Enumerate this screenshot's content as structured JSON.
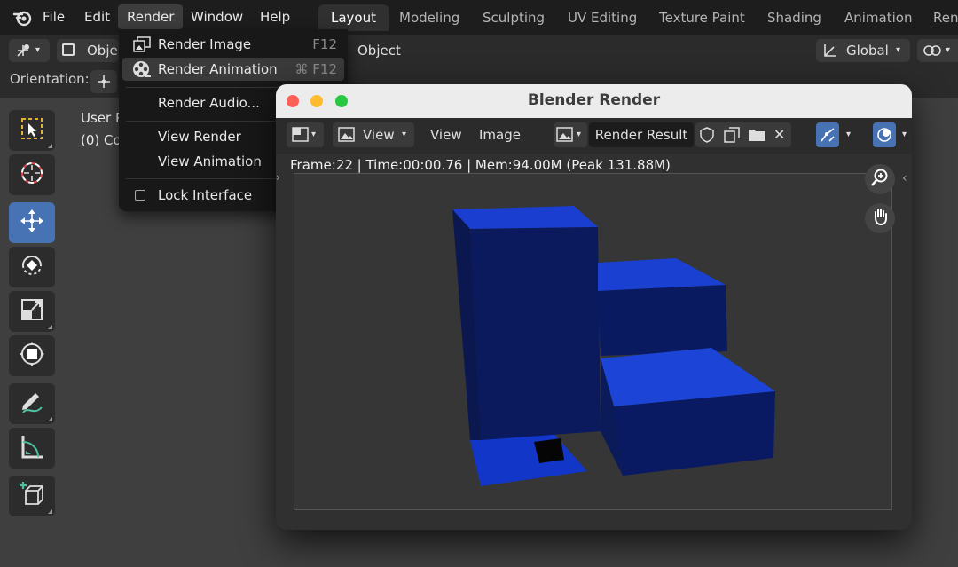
{
  "topbar": {
    "menus": [
      "File",
      "Edit",
      "Render",
      "Window",
      "Help"
    ],
    "workspaces": [
      "Layout",
      "Modeling",
      "Sculpting",
      "UV Editing",
      "Texture Paint",
      "Shading",
      "Animation",
      "Ren"
    ]
  },
  "header": {
    "object_mode": "Obje",
    "object_menu": "Object",
    "transform_orientation": "Global"
  },
  "orientation_label": "Orientation:",
  "viewport_info": {
    "line1": "User P",
    "line2": "(0) Co"
  },
  "render_menu": {
    "render_image": {
      "label": "Render Image",
      "shortcut": "F12"
    },
    "render_animation": {
      "label": "Render Animation",
      "shortcut": "⌘ F12"
    },
    "render_audio": {
      "label": "Render Audio..."
    },
    "view_render": {
      "label": "View Render"
    },
    "view_animation": {
      "label": "View Animation"
    },
    "lock_interface": {
      "label": "Lock Interface"
    }
  },
  "render_window": {
    "title": "Blender Render",
    "toolbar": {
      "view_dropdown": "View",
      "view_menu": "View",
      "image_menu": "Image",
      "image_name": "Render Result"
    },
    "stats": "Frame:22 | Time:00:00.76 | Mem:94.00M (Peak 131.88M)"
  },
  "colors": {
    "accent": "#4772b3",
    "cube_top": "#1a3fcf",
    "cube_side": "#0c1a5a",
    "traffic_red": "#fe5f57",
    "traffic_yellow": "#febc2e",
    "traffic_green": "#28c840"
  }
}
